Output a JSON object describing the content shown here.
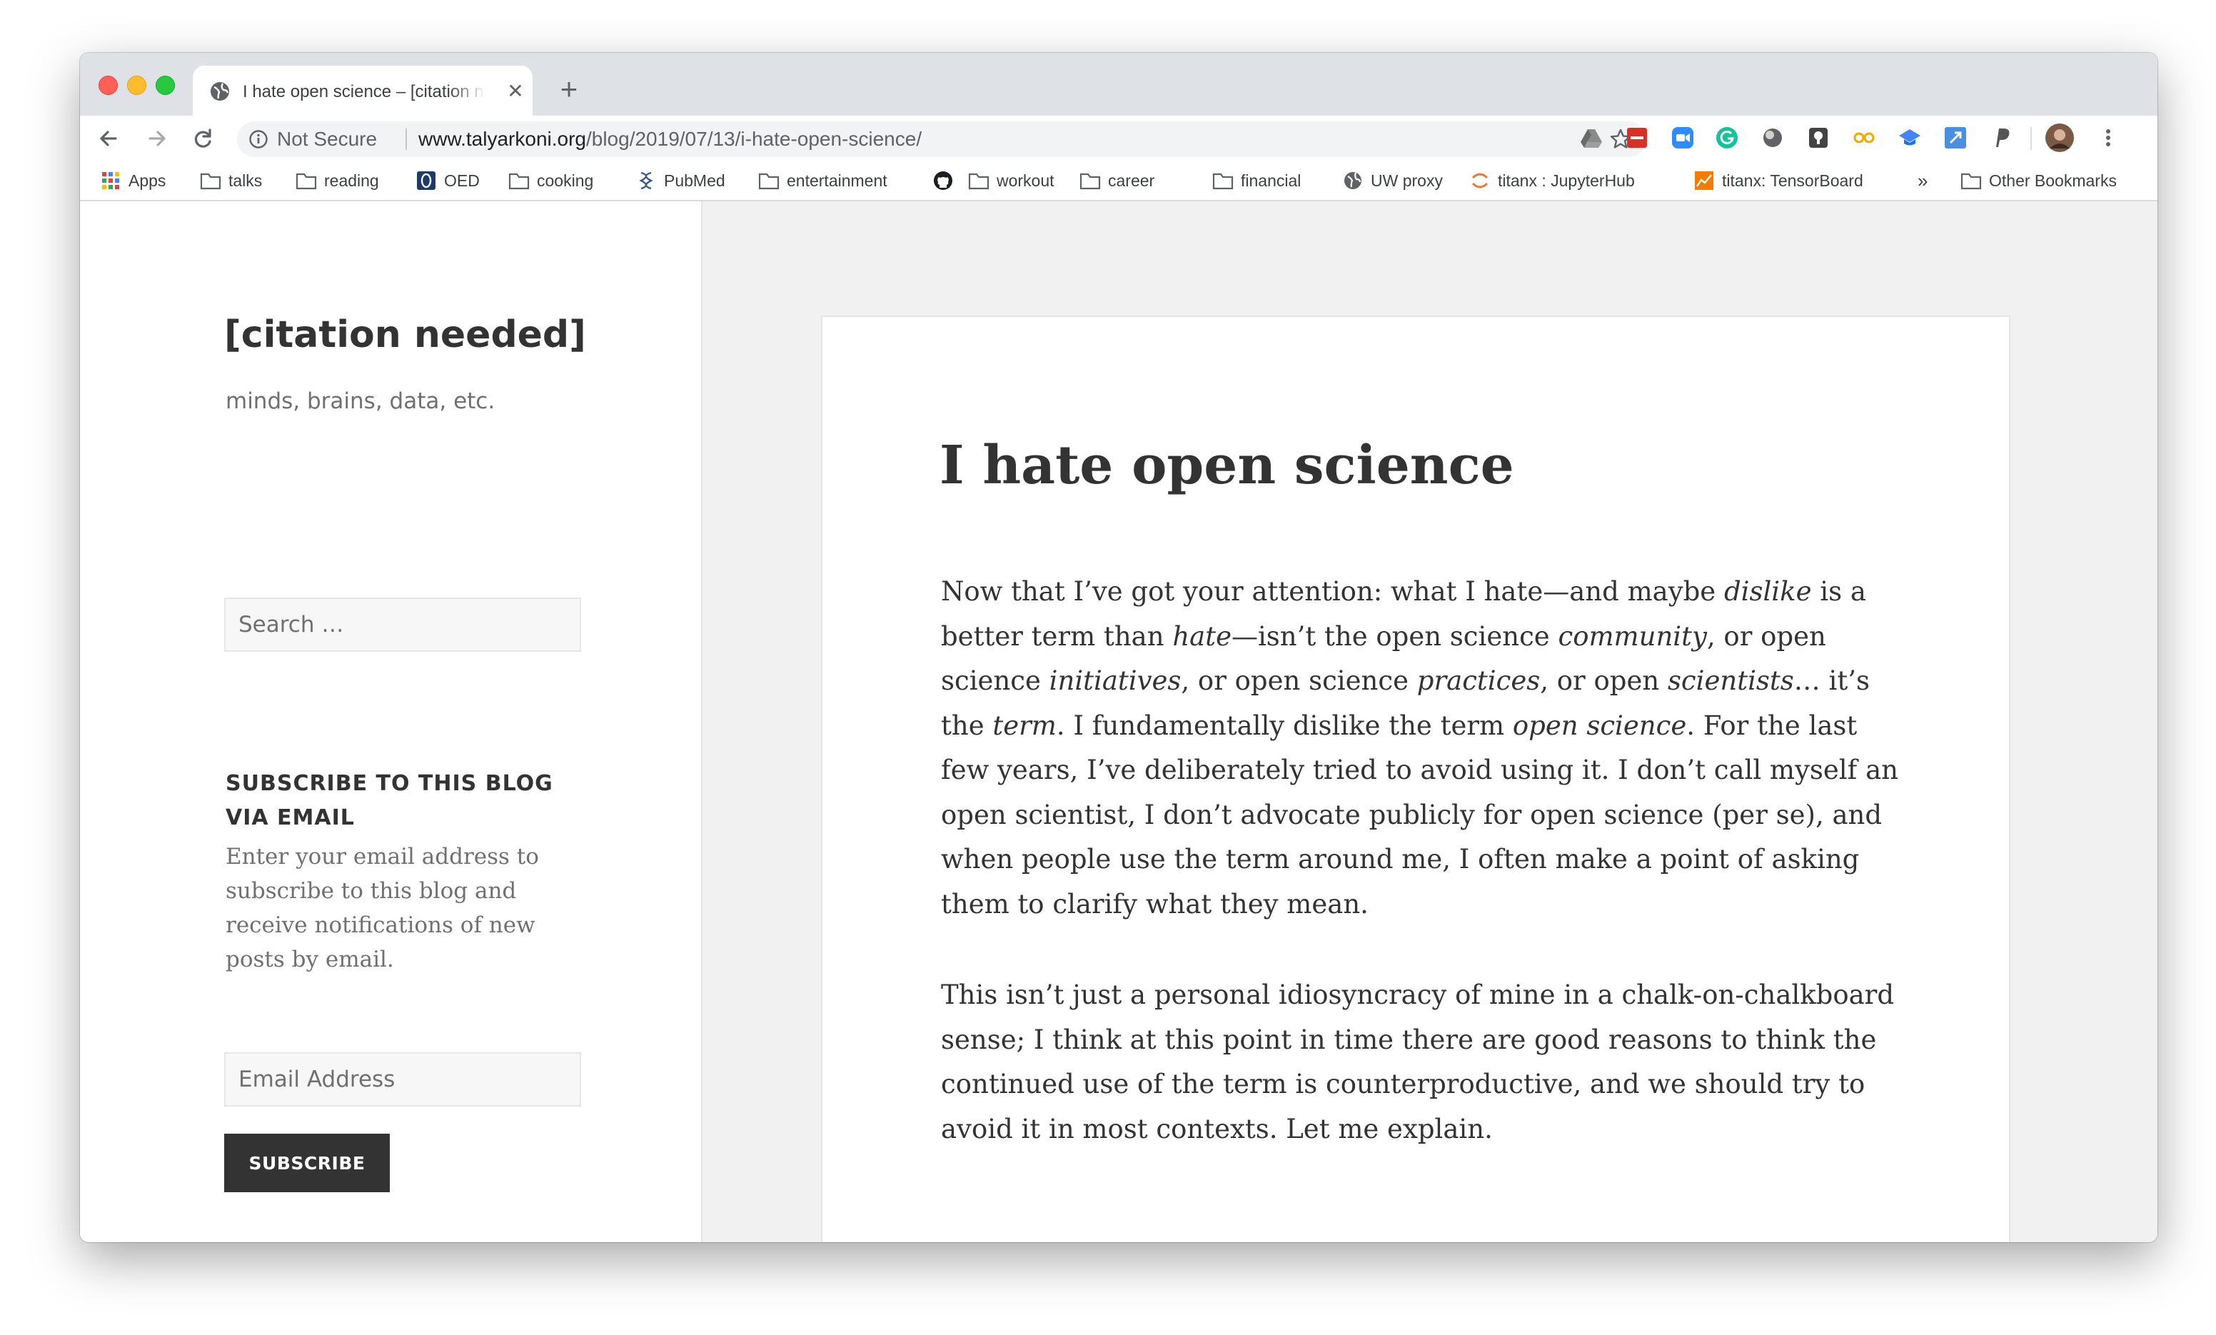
{
  "browser": {
    "tab": {
      "title": "I hate open science – [citation needed]",
      "close_glyph": "✕",
      "favicon": "globe-icon"
    },
    "new_tab_glyph": "+",
    "nav": [
      "back-icon",
      "forward-icon",
      "reload-icon"
    ],
    "address_bar": {
      "security_label": "Not Secure",
      "url_host": "www.talyarkoni.org",
      "url_path": "/blog/2019/07/13/i-hate-open-science/"
    },
    "extensions": [
      "google-drive-icon",
      "calendar-icon",
      "zoom-icon",
      "grammarly-icon",
      "circle-icon",
      "lastpass-icon",
      "glasses-icon",
      "scholar-icon",
      "link-icon",
      "paypal-icon",
      "profile-avatar",
      "menu-icon"
    ],
    "bookmarks": [
      {
        "label": "Apps",
        "icon": "apps-grid-icon"
      },
      {
        "label": "talks",
        "icon": "folder-icon"
      },
      {
        "label": "reading",
        "icon": "folder-icon"
      },
      {
        "label": "OED",
        "icon": "oed-icon"
      },
      {
        "label": "cooking",
        "icon": "folder-icon"
      },
      {
        "label": "PubMed",
        "icon": "pubmed-icon"
      },
      {
        "label": "entertainment",
        "icon": "folder-icon"
      },
      {
        "label": "",
        "icon": "github-icon"
      },
      {
        "label": "workout",
        "icon": "folder-icon"
      },
      {
        "label": "career",
        "icon": "folder-icon"
      },
      {
        "label": "financial",
        "icon": "folder-icon"
      },
      {
        "label": "UW proxy",
        "icon": "globe-icon"
      },
      {
        "label": "titanx : JupyterHub",
        "icon": "jupyter-icon"
      },
      {
        "label": "titanx: TensorBoard",
        "icon": "tensorboard-icon"
      }
    ],
    "more_bookmarks_glyph": "»",
    "other_bookmarks": "Other Bookmarks"
  },
  "sidebar": {
    "site_title": "[citation needed]",
    "site_description": "minds, brains, data, etc.",
    "search_placeholder": "Search …",
    "widget_title": "SUBSCRIBE TO THIS BLOG VIA EMAIL",
    "widget_text": "Enter your email address to subscribe to this blog and receive notifications of new posts by email.",
    "email_placeholder": "Email Address",
    "subscribe_label": "SUBSCRIBE"
  },
  "article": {
    "title": "I hate open science",
    "paragraphs": [
      {
        "segments": [
          {
            "t": "Now that I’ve got your attention: what I hate—and maybe "
          },
          {
            "t": "dislike",
            "em": true
          },
          {
            "t": " is a better term than "
          },
          {
            "t": "hate",
            "em": true
          },
          {
            "t": "—isn’t the open science "
          },
          {
            "t": "community",
            "em": true
          },
          {
            "t": ", or open science "
          },
          {
            "t": "initiatives",
            "em": true
          },
          {
            "t": ", or open science "
          },
          {
            "t": "practices",
            "em": true
          },
          {
            "t": ", or open "
          },
          {
            "t": "scientists",
            "em": true
          },
          {
            "t": "… it’s the "
          },
          {
            "t": "term",
            "em": true
          },
          {
            "t": ". I fundamentally dislike the term "
          },
          {
            "t": "open science",
            "em": true
          },
          {
            "t": ". For the last few years, I’ve deliberately tried to avoid using it. I don’t call myself an open scientist, I don’t advocate publicly for open science (per se), and when people use the term around me, I often make a point of asking them to clarify what they mean."
          }
        ]
      },
      {
        "segments": [
          {
            "t": "This isn’t just a personal idiosyncracy of mine in a chalk-on-chalkboard sense; I think at this point in time there are good reasons to think the continued use of the term is counterproductive, and we should try to avoid it in most contexts. Let me explain."
          }
        ]
      }
    ]
  }
}
